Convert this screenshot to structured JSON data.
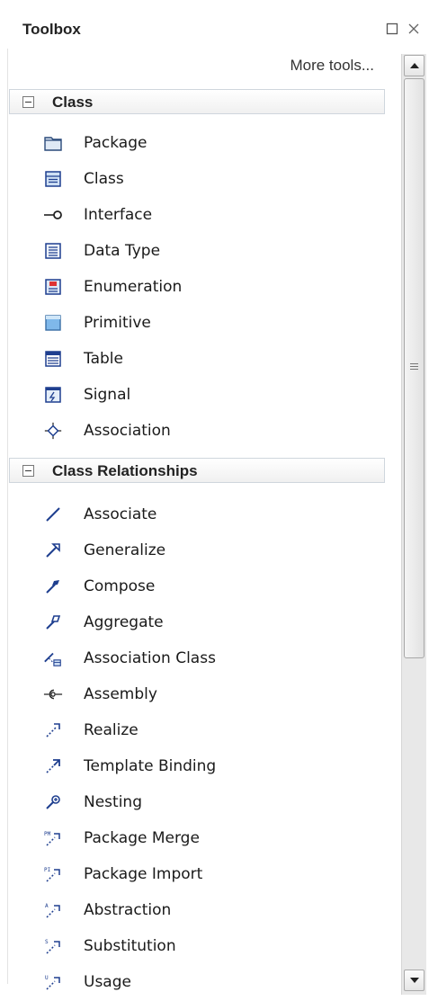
{
  "window": {
    "title": "Toolbox"
  },
  "toolbar": {
    "more_tools": "More tools..."
  },
  "groups": [
    {
      "label": "Class",
      "items": [
        {
          "label": "Package",
          "icon": "package-icon"
        },
        {
          "label": "Class",
          "icon": "class-icon"
        },
        {
          "label": "Interface",
          "icon": "interface-icon"
        },
        {
          "label": "Data Type",
          "icon": "data-type-icon"
        },
        {
          "label": "Enumeration",
          "icon": "enumeration-icon"
        },
        {
          "label": "Primitive",
          "icon": "primitive-icon"
        },
        {
          "label": "Table",
          "icon": "table-icon"
        },
        {
          "label": "Signal",
          "icon": "signal-icon"
        },
        {
          "label": "Association",
          "icon": "association-diamond-icon"
        }
      ]
    },
    {
      "label": "Class Relationships",
      "items": [
        {
          "label": "Associate",
          "icon": "associate-icon"
        },
        {
          "label": "Generalize",
          "icon": "generalize-icon"
        },
        {
          "label": "Compose",
          "icon": "compose-icon"
        },
        {
          "label": "Aggregate",
          "icon": "aggregate-icon"
        },
        {
          "label": "Association Class",
          "icon": "association-class-icon"
        },
        {
          "label": "Assembly",
          "icon": "assembly-icon"
        },
        {
          "label": "Realize",
          "icon": "realize-icon"
        },
        {
          "label": "Template Binding",
          "icon": "template-binding-icon"
        },
        {
          "label": "Nesting",
          "icon": "nesting-icon"
        },
        {
          "label": "Package Merge",
          "icon": "package-merge-icon"
        },
        {
          "label": "Package Import",
          "icon": "package-import-icon"
        },
        {
          "label": "Abstraction",
          "icon": "abstraction-icon"
        },
        {
          "label": "Substitution",
          "icon": "substitution-icon"
        },
        {
          "label": "Usage",
          "icon": "usage-icon"
        }
      ]
    }
  ],
  "colors": {
    "icon_blue": "#1f3f8f",
    "icon_light_blue": "#5b9bd5",
    "header_border": "#cfd6dd"
  }
}
